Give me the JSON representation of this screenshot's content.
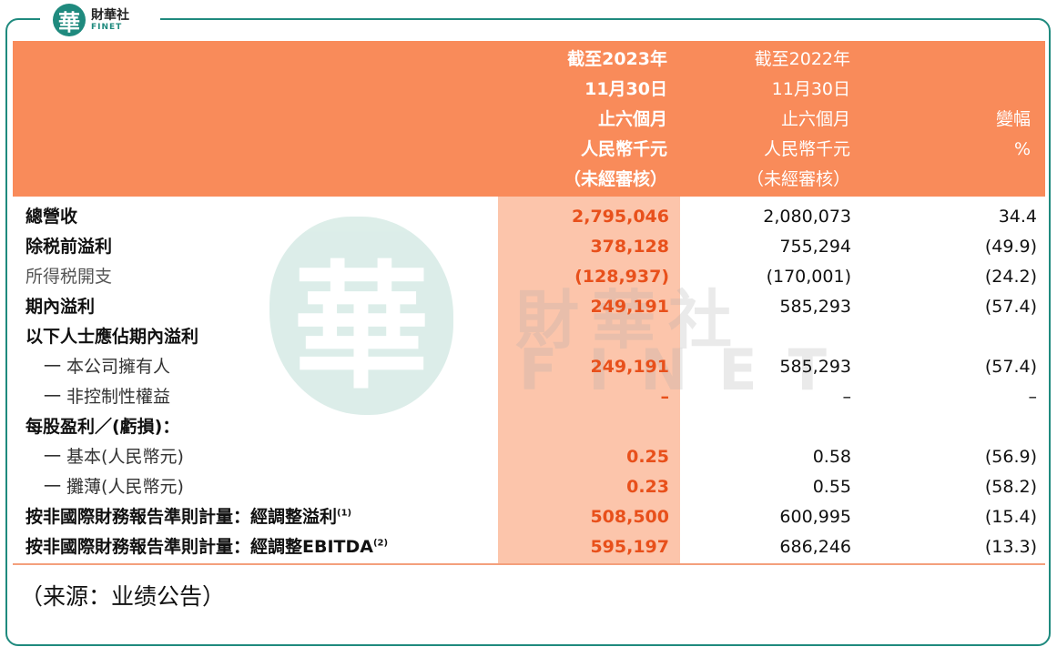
{
  "brand": {
    "mark": "華",
    "name_cn": "財華社",
    "name_en": "FINET"
  },
  "header": {
    "col_2023": [
      "截至2023年",
      "11月30日",
      "止六個月",
      "人民幣千元",
      "（未經審核）"
    ],
    "col_2022": [
      "截至2022年",
      "11月30日",
      "止六個月",
      "人民幣千元",
      "（未經審核）"
    ],
    "col_change": [
      "變幅",
      "%"
    ]
  },
  "rows": [
    {
      "label": "總營收",
      "v2023": "2,795,046",
      "v2022": "2,080,073",
      "change": "34.4"
    },
    {
      "label": "除税前溢利",
      "v2023": "378,128",
      "v2022": "755,294",
      "change": "(49.9)"
    },
    {
      "label": "所得税開支",
      "v2023": "(128,937)",
      "v2022": "(170,001)",
      "change": "(24.2)"
    },
    {
      "label": "期內溢利",
      "v2023": "249,191",
      "v2022": "585,293",
      "change": "(57.4)"
    },
    {
      "label": "以下人士應佔期內溢利",
      "v2023": "",
      "v2022": "",
      "change": ""
    },
    {
      "label": "一 本公司擁有人",
      "v2023": "249,191",
      "v2022": "585,293",
      "change": "(57.4)"
    },
    {
      "label": "一 非控制性權益",
      "v2023": "–",
      "v2022": "–",
      "change": "–"
    },
    {
      "label": "每股盈利／(虧損)：",
      "v2023": "",
      "v2022": "",
      "change": ""
    },
    {
      "label": "一 基本(人民幣元)",
      "v2023": "0.25",
      "v2022": "0.58",
      "change": "(56.9)"
    },
    {
      "label": "一 攤薄(人民幣元)",
      "v2023": "0.23",
      "v2022": "0.55",
      "change": "(58.2)"
    },
    {
      "label": "按非國際財務報告準則計量：經調整溢利",
      "note": "(1)",
      "v2023": "508,500",
      "v2022": "600,995",
      "change": "(15.4)"
    },
    {
      "label": "按非國際財務報告準則計量：經調整EBITDA",
      "note": "(2)",
      "v2023": "595,197",
      "v2022": "686,246",
      "change": "(13.3)"
    }
  ],
  "source": "（来源：业绩公告）",
  "watermark": {
    "cn": "財華社",
    "en": "FINET"
  },
  "colors": {
    "header_bg": "#f98b5a",
    "highlight_bg": "#fcc5ab",
    "highlight_text": "#e8501b",
    "brand_teal": "#1f8a7e"
  }
}
